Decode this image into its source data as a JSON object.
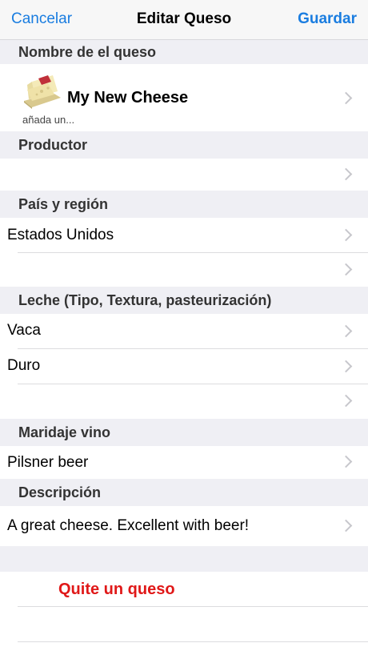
{
  "nav": {
    "cancel": "Cancelar",
    "title": "Editar Queso",
    "save": "Guardar"
  },
  "sections": {
    "name_header": "Nombre de el queso",
    "cheese_name": "My New Cheese",
    "cheese_subtitle": "añada un...",
    "producer_header": "Productor",
    "country_header": "País y región",
    "country_value": "Estados Unidos",
    "milk_header": "Leche (Tipo, Textura, pasteurización)",
    "milk_type": "Vaca",
    "milk_texture": "Duro",
    "wine_header": "Maridaje vino",
    "wine_value": "Pilsner beer",
    "desc_header": "Descripción",
    "desc_value": "A great cheese.  Excellent with beer!",
    "delete_label": "Quite un queso"
  },
  "colors": {
    "accent": "#1a7de0",
    "destructive": "#e01818",
    "background": "#efeff4"
  }
}
